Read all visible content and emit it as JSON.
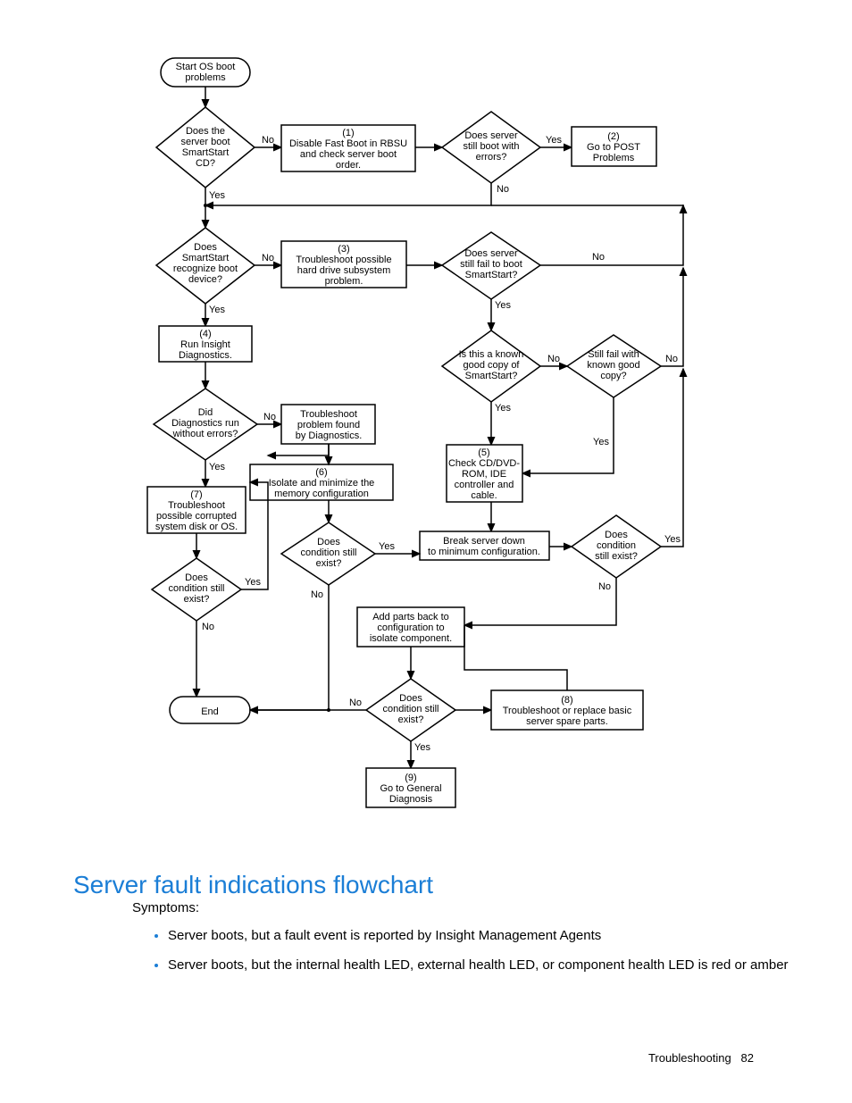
{
  "heading": "Server fault indications flowchart",
  "intro": "Symptoms:",
  "bullets": [
    "Server boots, but a fault event is reported by Insight Management Agents",
    "Server boots, but the internal health LED, external health LED, or component health LED is red or amber"
  ],
  "footer_section": "Troubleshooting",
  "footer_page": "82",
  "flowchart": {
    "nodes": {
      "start": {
        "type": "terminator",
        "text": [
          "Start OS boot",
          "problems"
        ]
      },
      "bootcd": {
        "type": "decision",
        "text": [
          "Does the",
          "server boot",
          "SmartStart",
          "CD?"
        ]
      },
      "p1": {
        "type": "process",
        "text": [
          "(1)",
          "Disable Fast Boot in RBSU",
          "and check server boot",
          "order."
        ]
      },
      "stillboot": {
        "type": "decision",
        "text": [
          "Does server",
          "still boot with",
          "errors?"
        ]
      },
      "p2": {
        "type": "process",
        "text": [
          "(2)",
          "Go to POST",
          "Problems"
        ]
      },
      "recognize": {
        "type": "decision",
        "text": [
          "Does",
          "SmartStart",
          "recognize boot",
          "device?"
        ]
      },
      "p3": {
        "type": "process",
        "text": [
          "(3)",
          "Troubleshoot possible",
          "hard drive subsystem",
          "problem."
        ]
      },
      "stillfail": {
        "type": "decision",
        "text": [
          "Does server",
          "still fail to boot",
          "SmartStart?"
        ]
      },
      "p4": {
        "type": "process",
        "text": [
          "(4)",
          "Run Insight",
          "Diagnostics."
        ]
      },
      "knowngood": {
        "type": "decision",
        "text": [
          "Is this a known",
          "good copy of",
          "SmartStart?"
        ]
      },
      "stillfailkg": {
        "type": "decision",
        "text": [
          "Still fail with",
          "known good",
          "copy?"
        ]
      },
      "diagerrors": {
        "type": "decision",
        "text": [
          "Did",
          "Diagnostics run",
          "without errors?"
        ]
      },
      "tsprob": {
        "type": "process",
        "text": [
          "Troubleshoot",
          "problem found",
          "by Diagnostics."
        ]
      },
      "p5": {
        "type": "process",
        "text": [
          "(5)",
          "Check CD/DVD-",
          "ROM, IDE",
          "controller and",
          "cable."
        ]
      },
      "p6": {
        "type": "process",
        "text": [
          "(6)",
          "Isolate and minimize the",
          "memory configuration"
        ]
      },
      "p7": {
        "type": "process",
        "text": [
          "(7)",
          "Troubleshoot",
          "possible corrupted",
          "system disk or OS."
        ]
      },
      "cond7": {
        "type": "decision",
        "text": [
          "Does",
          "condition still",
          "exist?"
        ]
      },
      "cond6": {
        "type": "decision",
        "text": [
          "Does",
          "condition still",
          "exist?"
        ]
      },
      "breakdown": {
        "type": "process",
        "text": [
          "Break server down",
          "to minimum configuration."
        ]
      },
      "cond5": {
        "type": "decision",
        "text": [
          "Does",
          "condition",
          "still exist?"
        ]
      },
      "addback": {
        "type": "process",
        "text": [
          "Add parts back to",
          "configuration to",
          "isolate component."
        ]
      },
      "end": {
        "type": "terminator",
        "text": [
          "End"
        ]
      },
      "cond8": {
        "type": "decision",
        "text": [
          "Does",
          "condition still",
          "exist?"
        ]
      },
      "p8": {
        "type": "process",
        "text": [
          "(8)",
          "Troubleshoot or replace basic",
          "server spare parts."
        ]
      },
      "p9": {
        "type": "process",
        "text": [
          "(9)",
          "Go to General",
          "Diagnosis"
        ]
      }
    },
    "edge_labels": {
      "yes": "Yes",
      "no": "No"
    }
  }
}
